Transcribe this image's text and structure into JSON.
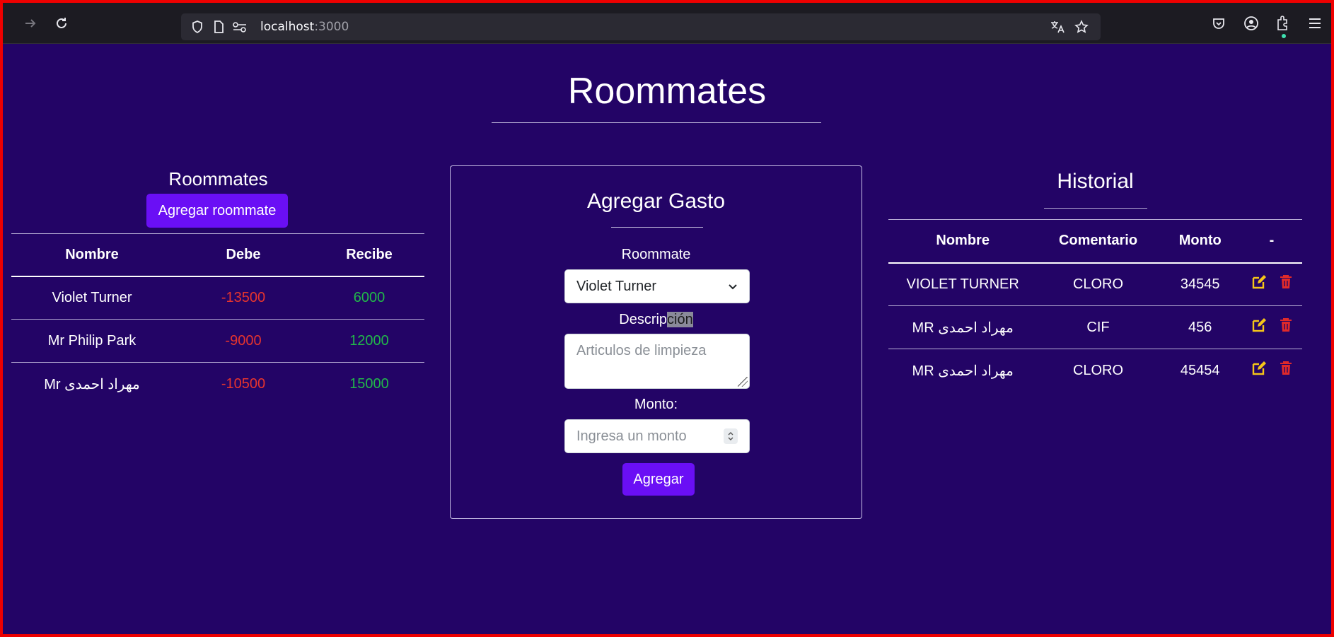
{
  "browser": {
    "url_host": "localhost",
    "url_port": ":3000"
  },
  "page": {
    "title": "Roommates"
  },
  "roommates": {
    "heading": "Roommates",
    "add_button": "Agregar roommate",
    "columns": [
      "Nombre",
      "Debe",
      "Recibe"
    ],
    "rows": [
      {
        "nombre": "Violet Turner",
        "debe": "-13500",
        "recibe": "6000"
      },
      {
        "nombre": "Mr Philip Park",
        "debe": "-9000",
        "recibe": "12000"
      },
      {
        "nombre": "Mr مهراد احمدی",
        "debe": "-10500",
        "recibe": "15000"
      }
    ]
  },
  "form": {
    "title": "Agregar Gasto",
    "roommate_label": "Roommate",
    "roommate_selected": "Violet Turner",
    "description_label_a": "Descrip",
    "description_label_b": "ción",
    "description_placeholder": "Articulos de limpieza",
    "amount_label": "Monto:",
    "amount_placeholder": "Ingresa un monto",
    "submit_label": "Agregar"
  },
  "historial": {
    "heading": "Historial",
    "columns": [
      "Nombre",
      "Comentario",
      "Monto",
      "-"
    ],
    "rows": [
      {
        "nombre": "VIOLET TURNER",
        "comentario": "CLORO",
        "monto": "34545"
      },
      {
        "nombre": "MR مهراد احمدی",
        "comentario": "CIF",
        "monto": "456"
      },
      {
        "nombre": "MR مهراد احمدی",
        "comentario": "CLORO",
        "monto": "45454"
      }
    ]
  },
  "colors": {
    "background": "#230466",
    "button": "#6a0ff5",
    "debe": "#e6342e",
    "recibe": "#21b84a",
    "edit_icon": "#f5c518",
    "delete_icon": "#e02a2a"
  },
  "icons": [
    "back-icon",
    "forward-icon",
    "reload-icon",
    "shield-icon",
    "page-icon",
    "site-info-icon",
    "translate-icon",
    "star-icon",
    "pocket-icon",
    "account-icon",
    "extensions-icon",
    "menu-icon",
    "edit-icon",
    "trash-icon",
    "chevron-down-icon"
  ]
}
